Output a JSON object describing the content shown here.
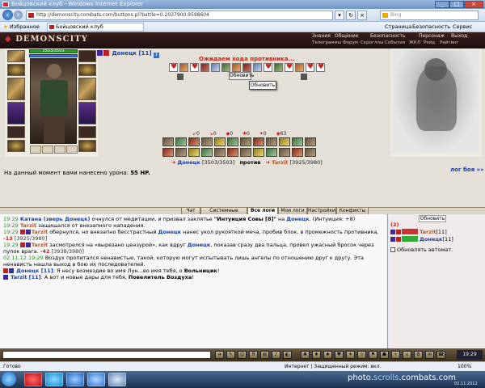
{
  "window": {
    "title": "Бойцовский клуб - Windows Internet Explorer",
    "url": "http://demonscity.combats.com/buttons.pl?battle=0.2037900.9598604",
    "search_placeholder": "Bing"
  },
  "favorites_bar": {
    "favorites_label": "Избранное",
    "tab_label": "Бойцовский клуб",
    "commands": [
      "Страница",
      "Безопасность",
      "Сервис"
    ]
  },
  "game": {
    "logo": "DEMONSCITY",
    "top_nav": [
      "Знания",
      "Общение",
      "Безопасность",
      "Персонаж",
      "Выход"
    ],
    "sub_nav": [
      "Телеграммы",
      "Форум",
      "Скрогллы",
      "События",
      "ЖКЛ",
      "Рейд",
      "Рейтинг"
    ]
  },
  "battle": {
    "player": {
      "name": "Донецк",
      "level": "[11]",
      "hp_text": "3503/3503",
      "hp_fraction": 1.0,
      "mp_fraction": 1.0
    },
    "waiting_text": "Ожидаем хода противника...",
    "refresh_button": "Обновить",
    "tooltip": "Обновить",
    "stats": [
      "0",
      "0",
      "0",
      "0",
      "0",
      "63"
    ],
    "versus": {
      "p1": "Донецк",
      "p1_hp": "[3503/3503]",
      "vs": "против",
      "p2": "Tarzit",
      "p2_hp": "[3925/3980]"
    },
    "damage_label": "На данный момент вами нанесено урона:",
    "damage_value": "55 HP.",
    "battle_log_link": "лог боя »»"
  },
  "chat_tabs": [
    "Чат",
    "Системные сообщения",
    "Все логи",
    "Мои логи",
    "Настройки",
    "Конфикты"
  ],
  "chat_active_tab": 2,
  "chat": {
    "m1_time": "19:29",
    "m1_name": "Катана (зверь Донецк)",
    "m1_text": " очнулся от медитации, и призвал заклятье ",
    "m1_spell": "\"Интуиция Совы [8]\"",
    "m1_text2": " на ",
    "m1_target": "Донецк",
    "m1_text3": ". (Интуиция: +8)",
    "m2_time": "19:29",
    "m2_name": "Tarzit",
    "m2_text": " защищался от внезапного нападения.",
    "m3_time": "19:29",
    "m3_name": "Tarzit",
    "m3_text": " обернулся, но внезапно бесстрастный ",
    "m3_name2": "Донецк",
    "m3_text2": " нанес укол рукояткой меча, пробив блок, в промежность противника. ",
    "m3_dmg": "-13",
    "m3_hp": "[3925/3980]",
    "m4_time": "19:29",
    "m4_name": "Tarzit",
    "m4_text": " засмотрелся на «вырезано цензурой», как вдруг ",
    "m4_name2": "Донецк",
    "m4_text2": ", показав сразу два пальца, провел ужасный бросок через пупок врага. ",
    "m4_dmg": "-42",
    "m4_hp": "[3938/3980]",
    "m5_time": "02.11.12 19:29",
    "m5_text": " Воздух пропитался ненавистью, такой, которую могут испытывать лишь ангелы по отношению друг к другу. Эта ненависть нашла выход в бою их последователей.",
    "m6_name": "Донецк [11]",
    "m6_text": ": Я несу возмездие во имя Лун...во имя тебя, о ",
    "m6_bold": "Вольницик",
    "m6_end": "!",
    "m7_name": "Tarzit [11]",
    "m7_text": ": А вот и новые дары для тебя, ",
    "m7_bold": "Повелитель Воздуха",
    "m7_end": "!"
  },
  "side_panel": {
    "update_button": "Обновить",
    "count": "(2)",
    "row1_name": "Tarzit",
    "row1_level": "[11]",
    "row2_name": "Донецк",
    "row2_level": "[11]",
    "auto_update_label": "Обновлять автомат."
  },
  "chatbar": {
    "clock": "19:29"
  },
  "statusbar": {
    "left": "Готово",
    "zone": "Интернет | Защищенный режим: вкл.",
    "zoom": "100%"
  },
  "taskbar": {
    "watermark_a": "photo.",
    "watermark_b": "scrolls",
    "watermark_c": ".combats.com",
    "date": "02.11.2012"
  },
  "colors": {
    "accent_red": "#c21",
    "player_blue": "#1a3ca0",
    "opponent_brown": "#b0542a",
    "time_green": "#2a8a2a"
  }
}
